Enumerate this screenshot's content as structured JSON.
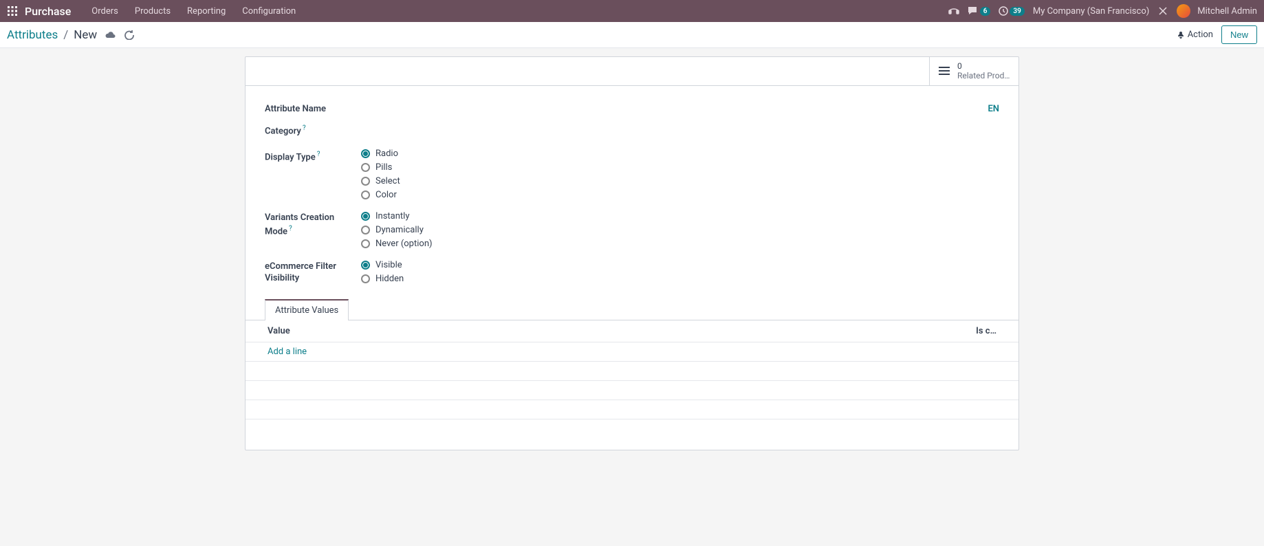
{
  "topbar": {
    "app_name": "Purchase",
    "menu": [
      "Orders",
      "Products",
      "Reporting",
      "Configuration"
    ],
    "chat_count": "6",
    "activity_count": "39",
    "company": "My Company (San Francisco)",
    "user": "Mitchell Admin"
  },
  "controlbar": {
    "breadcrumb_root": "Attributes",
    "breadcrumb_current": "New",
    "action_label": "Action",
    "new_label": "New"
  },
  "stat_box": {
    "count": "0",
    "label": "Related Prod…"
  },
  "form": {
    "attribute_name_label": "Attribute Name",
    "lang_tag": "EN",
    "category_label": "Category",
    "display_type_label": "Display Type",
    "display_type_options": [
      "Radio",
      "Pills",
      "Select",
      "Color"
    ],
    "display_type_selected": "Radio",
    "variants_label": "Variants Creation Mode",
    "variants_options": [
      "Instantly",
      "Dynamically",
      "Never (option)"
    ],
    "variants_selected": "Instantly",
    "ecommerce_label": "eCommerce Filter Visibility",
    "ecommerce_options": [
      "Visible",
      "Hidden"
    ],
    "ecommerce_selected": "Visible"
  },
  "tab": {
    "title": "Attribute Values"
  },
  "table": {
    "col_value": "Value",
    "col_custom": "Is c…",
    "add_line": "Add a line"
  }
}
